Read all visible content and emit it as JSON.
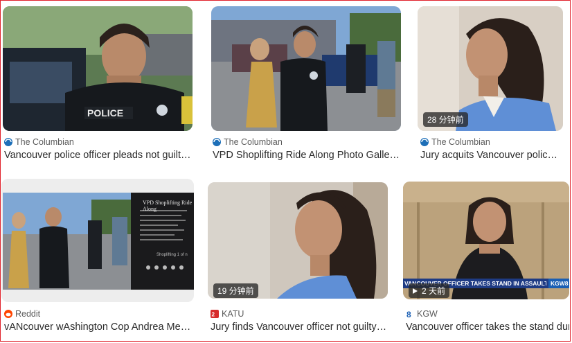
{
  "results": [
    {
      "source": "The Columbian",
      "title": "Vancouver police officer pleads not guilt…",
      "image": "officer-in-police-vest-photo"
    },
    {
      "source": "The Columbian",
      "title": "VPD Shoplifting Ride Along Photo Galler…",
      "image": "officers-escort-woman-photo"
    },
    {
      "source": "The Columbian",
      "title": "Jury acquits Vancouver polic…",
      "image": "woman-in-blue-profile-photo",
      "badge": "28 分钟前"
    },
    {
      "source": "Reddit",
      "title": "vANcouver wAshington Cop Andrea Me…",
      "image": "reddit-post-screenshot",
      "overlay": {
        "heading": "VPD Shoplifting Ride Along",
        "caption": "Shoplifting 1 of n"
      }
    },
    {
      "source": "KATU",
      "title": "Jury finds Vancouver officer not guilty…",
      "image": "woman-in-courtroom-profile-photo",
      "badge": "19 分钟前"
    },
    {
      "source": "KGW",
      "title": "Vancouver officer takes the stand dur",
      "image": "news-broadcast-still",
      "badge": "2 天前",
      "lower_third": "VANCOUVER OFFICER TAKES STAND IN ASSAULT CASE",
      "station_bug": "KGW8"
    }
  ],
  "colors": {
    "border": "#e0202a",
    "columbian": "#1d6fb8",
    "reddit": "#ff4500",
    "katu": "#d62b2b",
    "kgw": "#1a5fb4"
  }
}
